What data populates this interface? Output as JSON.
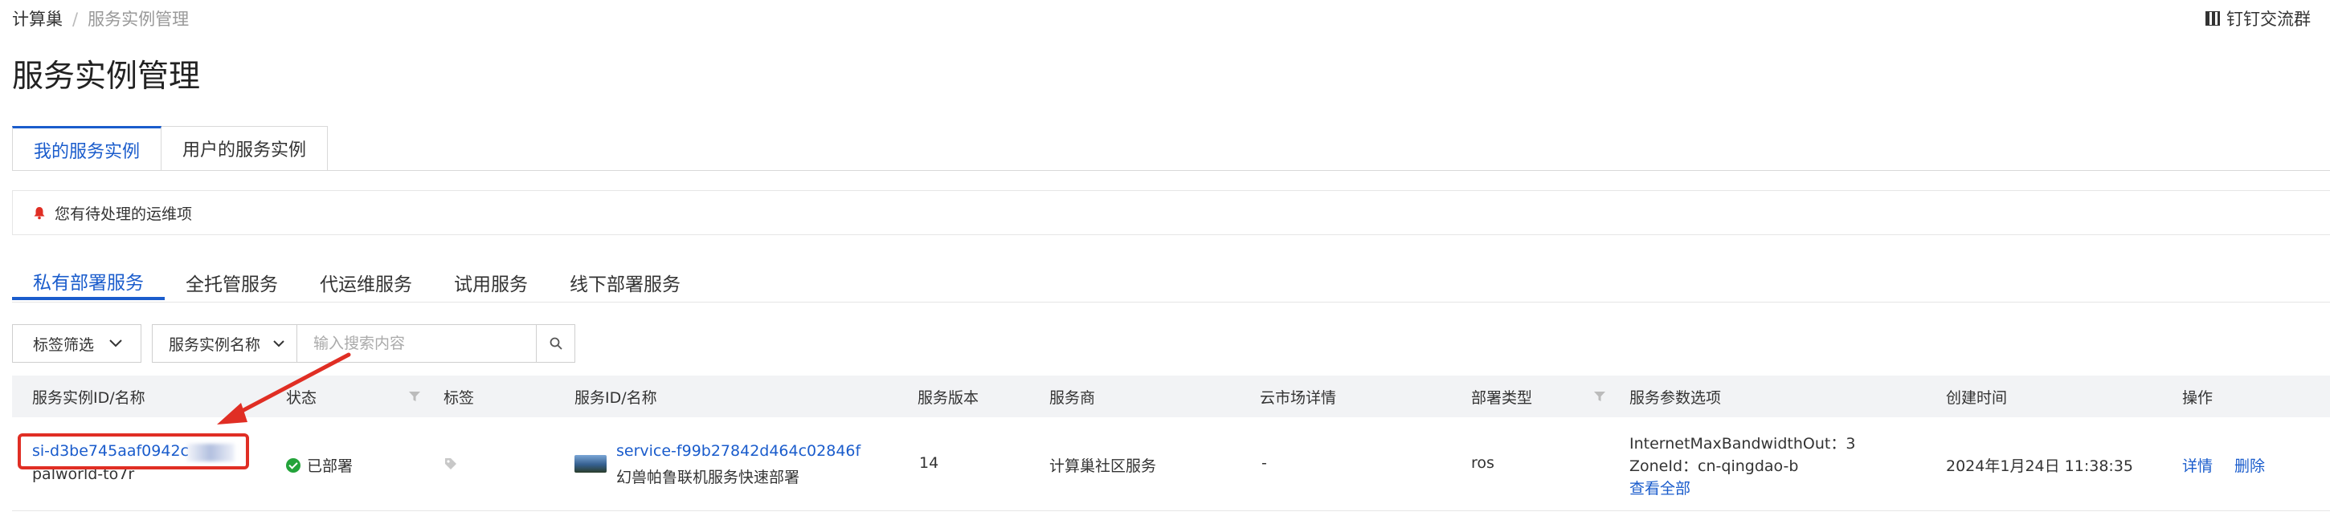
{
  "breadcrumb": {
    "root": "计算巢",
    "separator": "/",
    "current": "服务实例管理"
  },
  "top_right": {
    "label": "钉钉交流群"
  },
  "page_title": "服务实例管理",
  "tabs": [
    {
      "label": "我的服务实例",
      "active": true
    },
    {
      "label": "用户的服务实例",
      "active": false
    }
  ],
  "notice": {
    "text": "您有待处理的运维项"
  },
  "subtabs": [
    {
      "label": "私有部署服务",
      "active": true
    },
    {
      "label": "全托管服务",
      "active": false
    },
    {
      "label": "代运维服务",
      "active": false
    },
    {
      "label": "试用服务",
      "active": false
    },
    {
      "label": "线下部署服务",
      "active": false
    }
  ],
  "filters": {
    "tag_filter_label": "标签筛选",
    "search_field_label": "服务实例名称",
    "search_placeholder": "输入搜索内容"
  },
  "table": {
    "columns": [
      "服务实例ID/名称",
      "状态",
      "标签",
      "服务ID/名称",
      "服务版本",
      "服务商",
      "云市场详情",
      "部署类型",
      "服务参数选项",
      "创建时间",
      "操作"
    ],
    "rows": [
      {
        "instance_id": "si-d3be745aaf0942c",
        "instance_name": "palworld-to7r",
        "status": "已部署",
        "service_id": "service-f99b27842d464c02846f",
        "service_name": "幻兽帕鲁联机服务快速部署",
        "version": "14",
        "provider": "计算巢社区服务",
        "market_detail": "-",
        "deploy_type": "ros",
        "params": [
          "InternetMaxBandwidthOut：3",
          "ZoneId：cn-qingdao-b"
        ],
        "params_more": "查看全部",
        "created_at": "2024年1月24日 11:38:35",
        "actions": {
          "detail": "详情",
          "delete": "删除"
        }
      }
    ]
  },
  "colors": {
    "accent": "#1a5ccc",
    "success": "#23a33a",
    "annotation": "#e02e24"
  }
}
